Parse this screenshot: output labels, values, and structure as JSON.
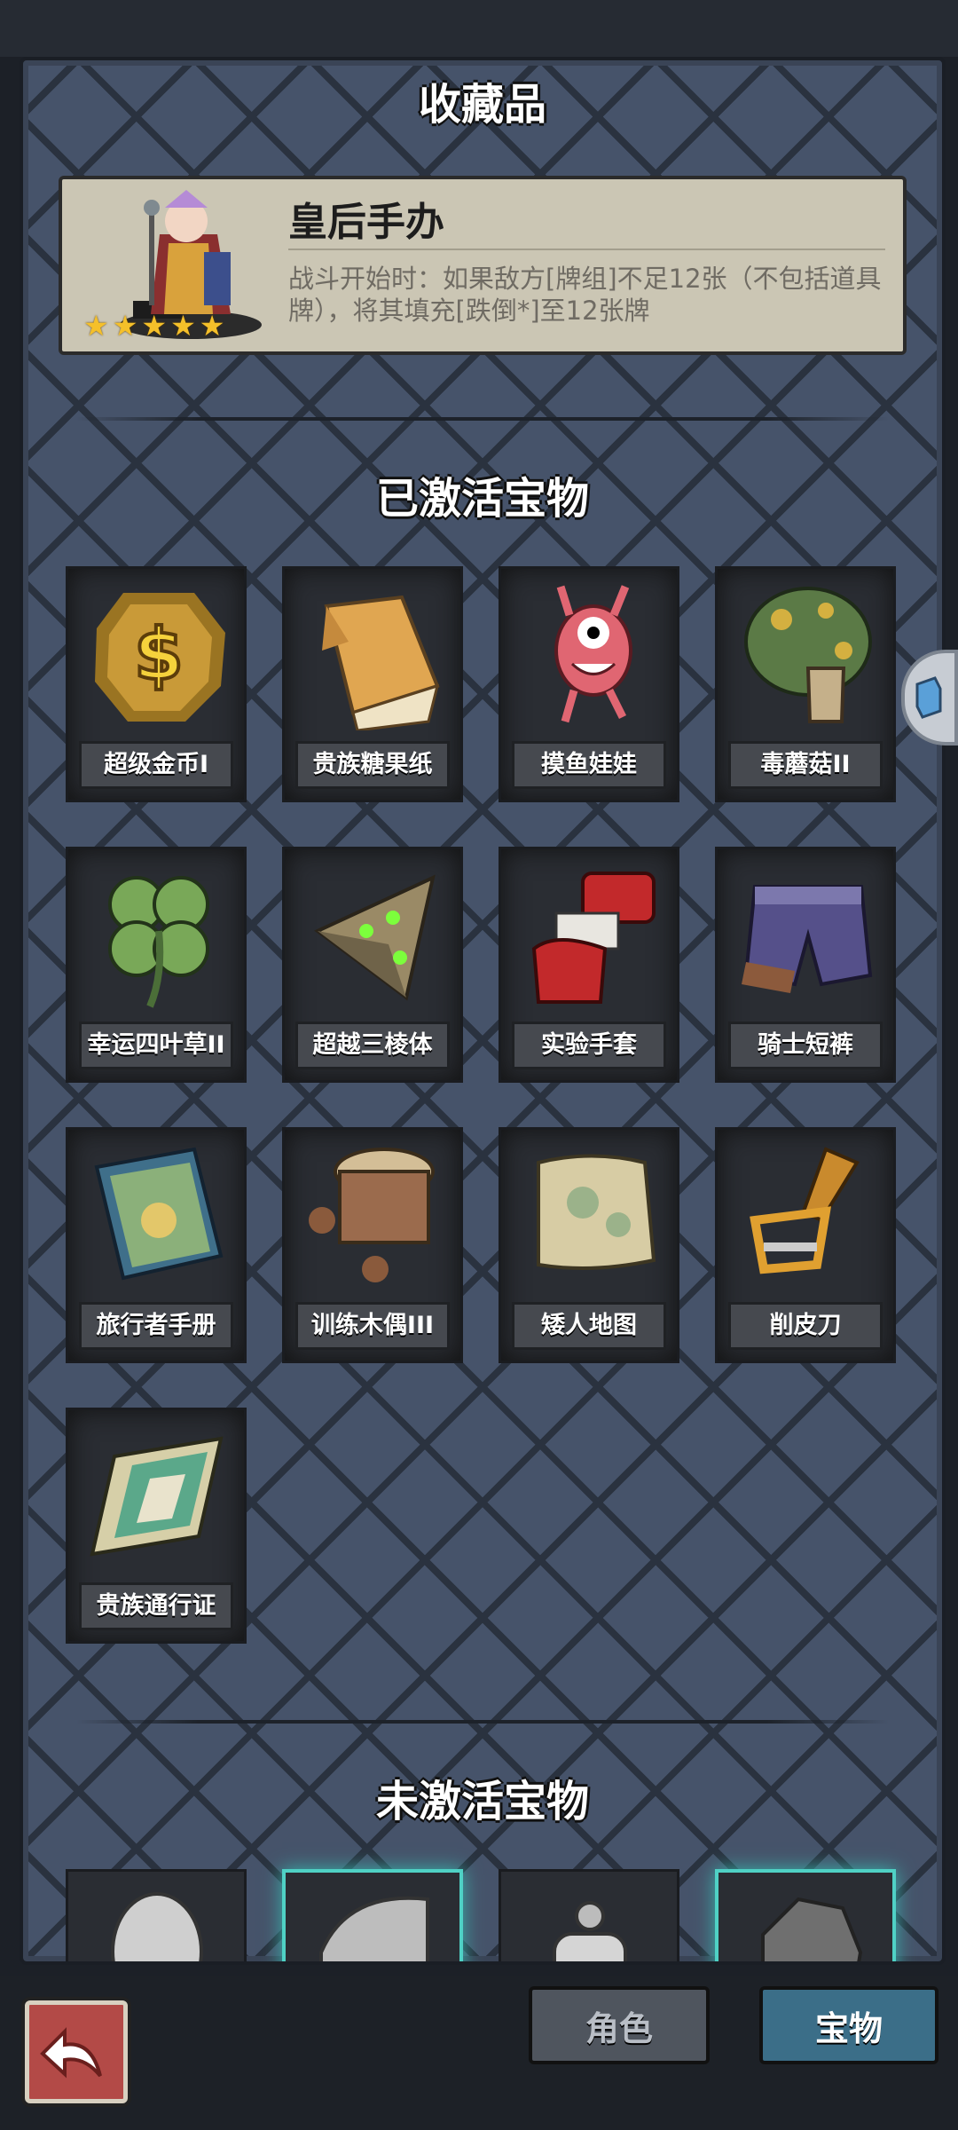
{
  "header": {
    "title": "收藏品"
  },
  "featured": {
    "name": "皇后手办",
    "description": "战斗开始时：如果敌方[牌组]不足12张（不包括道具牌），将其填充[跌倒*]至12张牌",
    "stars": 5
  },
  "activated": {
    "title": "已激活宝物",
    "items": [
      {
        "label": "超级金币I",
        "icon": "gold-coin-icon"
      },
      {
        "label": "贵族糖果纸",
        "icon": "candy-wrapper-icon"
      },
      {
        "label": "摸鱼娃娃",
        "icon": "fish-doll-icon"
      },
      {
        "label": "毒蘑菇II",
        "icon": "poison-mushroom-icon"
      },
      {
        "label": "幸运四叶草II",
        "icon": "four-leaf-clover-icon"
      },
      {
        "label": "超越三棱体",
        "icon": "triangular-prism-icon"
      },
      {
        "label": "实验手套",
        "icon": "lab-glove-icon"
      },
      {
        "label": "骑士短裤",
        "icon": "knight-shorts-icon"
      },
      {
        "label": "旅行者手册",
        "icon": "travel-guide-icon"
      },
      {
        "label": "训练木偶III",
        "icon": "training-dummy-icon"
      },
      {
        "label": "矮人地图",
        "icon": "dwarf-map-icon"
      },
      {
        "label": "削皮刀",
        "icon": "peeler-icon"
      },
      {
        "label": "贵族通行证",
        "icon": "noble-pass-icon"
      }
    ]
  },
  "inactive": {
    "title": "未激活宝物",
    "items": [
      {
        "icon": "silver-egg-icon",
        "glow": false
      },
      {
        "icon": "cracked-egg-icon",
        "glow": true
      },
      {
        "icon": "bomb-figure-icon",
        "glow": false
      },
      {
        "icon": "ore-rock-icon",
        "glow": true
      }
    ]
  },
  "bottom_nav": {
    "back_icon": "back-arrow-icon",
    "tab_role": "角色",
    "tab_treasure": "宝物"
  },
  "colors": {
    "accent": "#3b6e88",
    "card_glow": "#4fd1c5",
    "star": "#f5c02a"
  }
}
